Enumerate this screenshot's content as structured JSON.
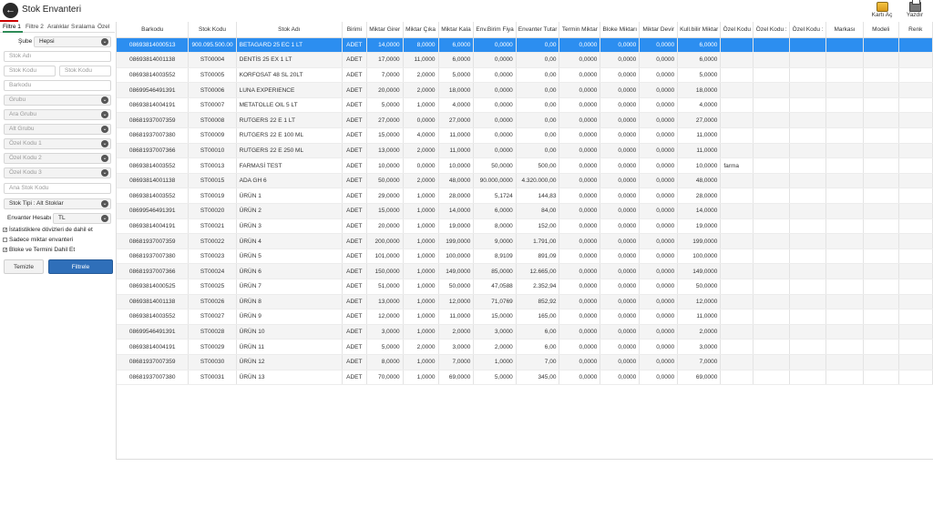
{
  "window": {
    "title": "Stok Envanteri"
  },
  "toolbar": {
    "karti_ac": "Kartı Aç",
    "yazdir": "Yazdır"
  },
  "tabs": [
    "Filtre 1",
    "Filtre 2",
    "Aralıklar",
    "Sıralama",
    "Özel"
  ],
  "filters": {
    "sube_label": "Şube",
    "sube_value": "Hepsi",
    "stok_adi": "Stok Adı",
    "stok_kodu_1": "Stok Kodu",
    "stok_kodu_2": "Stok Kodu",
    "barkodu": "Barkodu",
    "grubu": "Grubu",
    "ara_grubu": "Ara Grubu",
    "alt_grubu": "Alt Grubu",
    "ozel_kodu_1": "Özel Kodu 1",
    "ozel_kodu_2": "Özel Kodu 2",
    "ozel_kodu_3": "Özel Kodu 3",
    "ana_stok_kodu": "Ana Stok Kodu",
    "stok_tipi": "Stok Tipi : Alt Stoklar",
    "envanter_hesabi_label": "Envanter Hesabı",
    "envanter_hesabi_value": "TL",
    "chk1": "İstatistiklere dövizleri de dahil et",
    "chk2": "Sadece miktar envanteri",
    "chk3": "Bloke ve Termini Dahil Et",
    "btn_clear": "Temizle",
    "btn_filter": "Filtrele"
  },
  "columns": [
    "Barkodu",
    "Stok Kodu",
    "Stok Adı",
    "Birimi",
    "Miktar Girer",
    "Miktar Çıka",
    "Miktar Kala",
    "Env.Birim Fiya",
    "Envanter Tutar",
    "Termin Miktar",
    "Bloke Miktarı",
    "Miktar Devir",
    "Kull.bilir Miktar",
    "Özel Kodu",
    "Özel Kodu :",
    "Özel Kodu :",
    "Markası",
    "Modeli",
    "Renk"
  ],
  "rows": [
    [
      "08693814000513",
      "900.095.500.00",
      "BETAGARD 25 EC 1 LT",
      "ADET",
      "14,0000",
      "8,0000",
      "6,0000",
      "0,0000",
      "0,00",
      "0,0000",
      "0,0000",
      "0,0000",
      "6,0000",
      "",
      "",
      "",
      "",
      "",
      ""
    ],
    [
      "08693814001138",
      "ST00004",
      "DENTİS 25 EX 1 LT",
      "ADET",
      "17,0000",
      "11,0000",
      "6,0000",
      "0,0000",
      "0,00",
      "0,0000",
      "0,0000",
      "0,0000",
      "6,0000",
      "",
      "",
      "",
      "",
      "",
      ""
    ],
    [
      "08693814003552",
      "ST00005",
      "KORFOSAT 48 SL 20LT",
      "ADET",
      "7,0000",
      "2,0000",
      "5,0000",
      "0,0000",
      "0,00",
      "0,0000",
      "0,0000",
      "0,0000",
      "5,0000",
      "",
      "",
      "",
      "",
      "",
      ""
    ],
    [
      "08699546491391",
      "ST00006",
      "LUNA EXPERIENCE",
      "ADET",
      "20,0000",
      "2,0000",
      "18,0000",
      "0,0000",
      "0,00",
      "0,0000",
      "0,0000",
      "0,0000",
      "18,0000",
      "",
      "",
      "",
      "",
      "",
      ""
    ],
    [
      "08693814004191",
      "ST00007",
      "METATOLLE OIL 5 LT",
      "ADET",
      "5,0000",
      "1,0000",
      "4,0000",
      "0,0000",
      "0,00",
      "0,0000",
      "0,0000",
      "0,0000",
      "4,0000",
      "",
      "",
      "",
      "",
      "",
      ""
    ],
    [
      "08681937007359",
      "ST00008",
      "RUTGERS 22 E 1 LT",
      "ADET",
      "27,0000",
      "0,0000",
      "27,0000",
      "0,0000",
      "0,00",
      "0,0000",
      "0,0000",
      "0,0000",
      "27,0000",
      "",
      "",
      "",
      "",
      "",
      ""
    ],
    [
      "08681937007380",
      "ST00009",
      "RUTGERS 22 E 100 ML",
      "ADET",
      "15,0000",
      "4,0000",
      "11,0000",
      "0,0000",
      "0,00",
      "0,0000",
      "0,0000",
      "0,0000",
      "11,0000",
      "",
      "",
      "",
      "",
      "",
      ""
    ],
    [
      "08681937007366",
      "ST00010",
      "RUTGERS 22 E 250 ML",
      "ADET",
      "13,0000",
      "2,0000",
      "11,0000",
      "0,0000",
      "0,00",
      "0,0000",
      "0,0000",
      "0,0000",
      "11,0000",
      "",
      "",
      "",
      "",
      "",
      ""
    ],
    [
      "08693814003552",
      "ST00013",
      "FARMASİ TEST",
      "ADET",
      "10,0000",
      "0,0000",
      "10,0000",
      "50,0000",
      "500,00",
      "0,0000",
      "0,0000",
      "0,0000",
      "10,0000",
      "farma",
      "",
      "",
      "",
      "",
      ""
    ],
    [
      "08693814001138",
      "ST00015",
      "ADA GH 6",
      "ADET",
      "50,0000",
      "2,0000",
      "48,0000",
      "90.000,0000",
      "4.320.000,00",
      "0,0000",
      "0,0000",
      "0,0000",
      "48,0000",
      "",
      "",
      "",
      "",
      "",
      ""
    ],
    [
      "08693814003552",
      "ST00019",
      "ÜRÜN 1",
      "ADET",
      "29,0000",
      "1,0000",
      "28,0000",
      "5,1724",
      "144,83",
      "0,0000",
      "0,0000",
      "0,0000",
      "28,0000",
      "",
      "",
      "",
      "",
      "",
      ""
    ],
    [
      "08699546491391",
      "ST00020",
      "ÜRÜN 2",
      "ADET",
      "15,0000",
      "1,0000",
      "14,0000",
      "6,0000",
      "84,00",
      "0,0000",
      "0,0000",
      "0,0000",
      "14,0000",
      "",
      "",
      "",
      "",
      "",
      ""
    ],
    [
      "08693814004191",
      "ST00021",
      "ÜRÜN 3",
      "ADET",
      "20,0000",
      "1,0000",
      "19,0000",
      "8,0000",
      "152,00",
      "0,0000",
      "0,0000",
      "0,0000",
      "19,0000",
      "",
      "",
      "",
      "",
      "",
      ""
    ],
    [
      "08681937007359",
      "ST00022",
      "ÜRÜN 4",
      "ADET",
      "200,0000",
      "1,0000",
      "199,0000",
      "9,0000",
      "1.791,00",
      "0,0000",
      "0,0000",
      "0,0000",
      "199,0000",
      "",
      "",
      "",
      "",
      "",
      ""
    ],
    [
      "08681937007380",
      "ST00023",
      "ÜRÜN 5",
      "ADET",
      "101,0000",
      "1,0000",
      "100,0000",
      "8,9109",
      "891,09",
      "0,0000",
      "0,0000",
      "0,0000",
      "100,0000",
      "",
      "",
      "",
      "",
      "",
      ""
    ],
    [
      "08681937007366",
      "ST00024",
      "ÜRÜN 6",
      "ADET",
      "150,0000",
      "1,0000",
      "149,0000",
      "85,0000",
      "12.665,00",
      "0,0000",
      "0,0000",
      "0,0000",
      "149,0000",
      "",
      "",
      "",
      "",
      "",
      ""
    ],
    [
      "08693814000525",
      "ST00025",
      "ÜRÜN 7",
      "ADET",
      "51,0000",
      "1,0000",
      "50,0000",
      "47,0588",
      "2.352,94",
      "0,0000",
      "0,0000",
      "0,0000",
      "50,0000",
      "",
      "",
      "",
      "",
      "",
      ""
    ],
    [
      "08693814001138",
      "ST00026",
      "ÜRÜN 8",
      "ADET",
      "13,0000",
      "1,0000",
      "12,0000",
      "71,0769",
      "852,92",
      "0,0000",
      "0,0000",
      "0,0000",
      "12,0000",
      "",
      "",
      "",
      "",
      "",
      ""
    ],
    [
      "08693814003552",
      "ST00027",
      "ÜRÜN 9",
      "ADET",
      "12,0000",
      "1,0000",
      "11,0000",
      "15,0000",
      "165,00",
      "0,0000",
      "0,0000",
      "0,0000",
      "11,0000",
      "",
      "",
      "",
      "",
      "",
      ""
    ],
    [
      "08699546491391",
      "ST00028",
      "ÜRÜN 10",
      "ADET",
      "3,0000",
      "1,0000",
      "2,0000",
      "3,0000",
      "6,00",
      "0,0000",
      "0,0000",
      "0,0000",
      "2,0000",
      "",
      "",
      "",
      "",
      "",
      ""
    ],
    [
      "08693814004191",
      "ST00029",
      "ÜRÜN 11",
      "ADET",
      "5,0000",
      "2,0000",
      "3,0000",
      "2,0000",
      "6,00",
      "0,0000",
      "0,0000",
      "0,0000",
      "3,0000",
      "",
      "",
      "",
      "",
      "",
      ""
    ],
    [
      "08681937007359",
      "ST00030",
      "ÜRÜN 12",
      "ADET",
      "8,0000",
      "1,0000",
      "7,0000",
      "1,0000",
      "7,00",
      "0,0000",
      "0,0000",
      "0,0000",
      "7,0000",
      "",
      "",
      "",
      "",
      "",
      ""
    ],
    [
      "08681937007380",
      "ST00031",
      "ÜRÜN 13",
      "ADET",
      "70,0000",
      "1,0000",
      "69,0000",
      "5,0000",
      "345,00",
      "0,0000",
      "0,0000",
      "0,0000",
      "69,0000",
      "",
      "",
      "",
      "",
      "",
      ""
    ]
  ],
  "colors": {
    "selected_row": "#2c8ef0",
    "filter_button": "#2f6fb9",
    "active_tab": "#2e8b57"
  }
}
